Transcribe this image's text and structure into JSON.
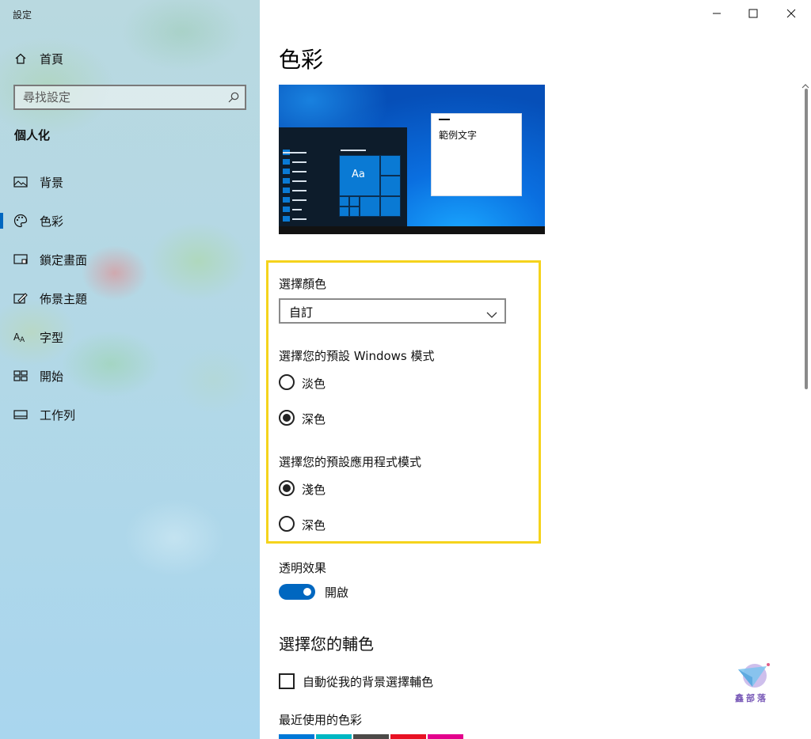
{
  "window": {
    "title": "設定"
  },
  "sidebar": {
    "home_label": "首頁",
    "search_placeholder": "尋找設定",
    "section_heading": "個人化",
    "items": [
      {
        "label": "背景",
        "icon": "picture-icon"
      },
      {
        "label": "色彩",
        "icon": "palette-icon",
        "selected": true
      },
      {
        "label": "鎖定畫面",
        "icon": "lock-screen-icon"
      },
      {
        "label": "佈景主題",
        "icon": "theme-icon"
      },
      {
        "label": "字型",
        "icon": "font-icon"
      },
      {
        "label": "開始",
        "icon": "start-icon"
      },
      {
        "label": "工作列",
        "icon": "taskbar-icon"
      }
    ]
  },
  "main": {
    "title": "色彩",
    "preview": {
      "sample_text": "範例文字",
      "tile_text": "Aa"
    },
    "choose_color": {
      "label": "選擇顏色",
      "value": "自訂"
    },
    "windows_mode": {
      "label": "選擇您的預設 Windows 模式",
      "options": [
        {
          "label": "淡色",
          "checked": false
        },
        {
          "label": "深色",
          "checked": true
        }
      ]
    },
    "app_mode": {
      "label": "選擇您的預設應用程式模式",
      "options": [
        {
          "label": "淺色",
          "checked": true
        },
        {
          "label": "深色",
          "checked": false
        }
      ]
    },
    "transparency": {
      "label": "透明效果",
      "state_label": "開啟",
      "on": true
    },
    "accent": {
      "heading": "選擇您的輔色",
      "auto_pick_label": "自動從我的背景選擇輔色",
      "auto_pick_checked": false,
      "recent_label": "最近使用的色彩",
      "recent_colors": [
        "#0078d7",
        "#00b7c3",
        "#4c4a48",
        "#e81123",
        "#e3008c"
      ]
    }
  },
  "colors": {
    "accent": "#0067c0",
    "highlight_border": "#f5d31c"
  },
  "watermark": {
    "text": "鑫部落"
  }
}
